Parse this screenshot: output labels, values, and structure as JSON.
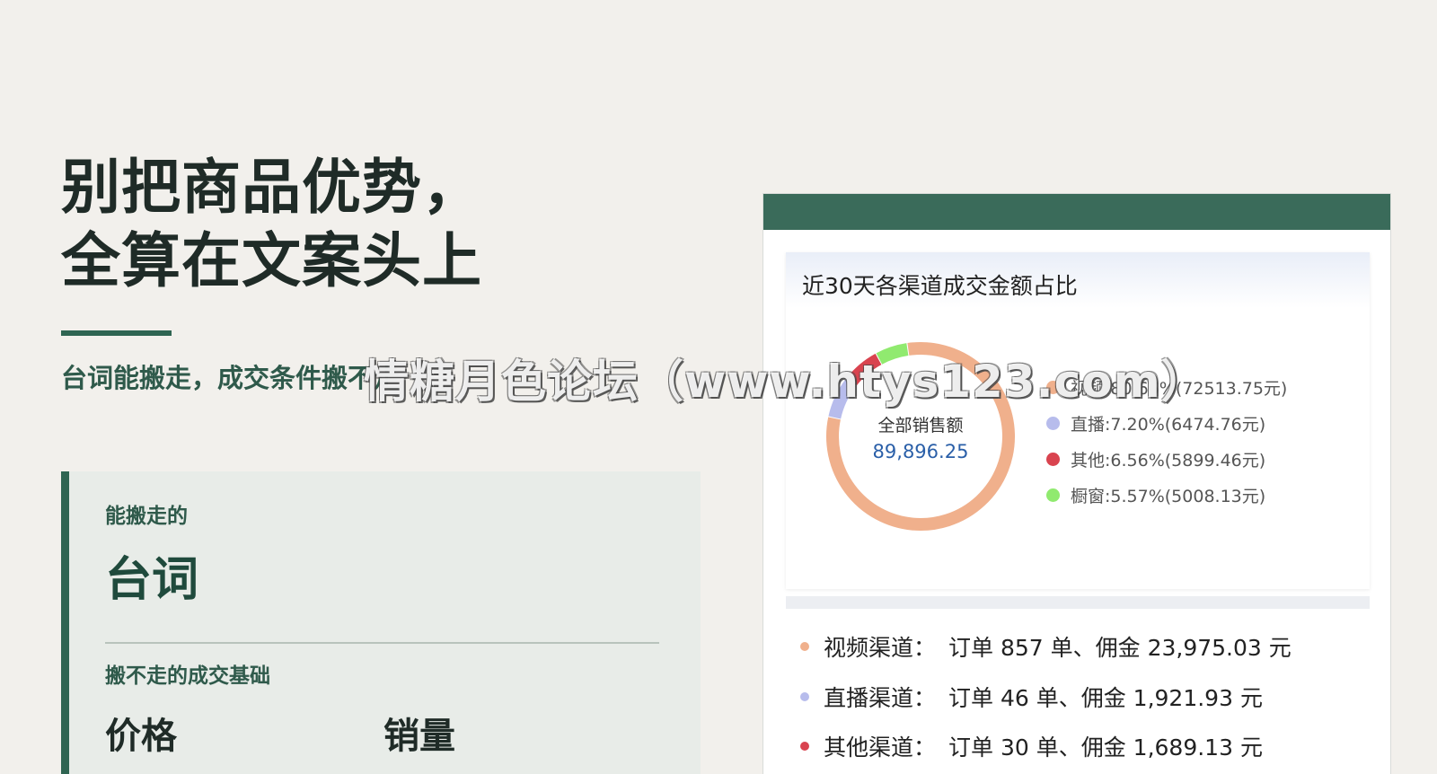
{
  "headline": {
    "line1": "别把商品优势，",
    "line2": "全算在文案头上"
  },
  "subtitle": "台词能搬走，成交条件搬不走",
  "info_card": {
    "kicker1": "能搬走的",
    "main": "台词",
    "kicker2": "搬不走的成交基础",
    "items": [
      "价格",
      "销量"
    ]
  },
  "colors": {
    "accent_green": "#2f6552",
    "panel_bar": "#3a6b5a",
    "video": "#f0b08c",
    "live": "#b7bcec",
    "other": "#d9434f",
    "window": "#90ea6f",
    "value_blue": "#2a5fa8"
  },
  "panel": {
    "chart_title": "近30天各渠道成交金额占比",
    "center_label": "全部销售额",
    "center_value": "89,896.25",
    "legend": [
      {
        "label": "视频:80.66%(72513.75元)",
        "color": "#f0b08c"
      },
      {
        "label": "直播:7.20%(6474.76元)",
        "color": "#b7bcec"
      },
      {
        "label": "其他:6.56%(5899.46元)",
        "color": "#d9434f"
      },
      {
        "label": "橱窗:5.57%(5008.13元)",
        "color": "#90ea6f"
      }
    ],
    "lines": [
      {
        "label": "视频渠道：",
        "text": "订单 857 单、佣金 23,975.03 元",
        "color": "#f0b08c"
      },
      {
        "label": "直播渠道：",
        "text": "订单 46 单、佣金 1,921.93 元",
        "color": "#b7bcec"
      },
      {
        "label": "其他渠道：",
        "text": "订单 30 单、佣金 1,689.13 元",
        "color": "#d9434f"
      }
    ]
  },
  "chart_data": {
    "type": "pie",
    "title": "近30天各渠道成交金额占比",
    "categories": [
      "视频",
      "直播",
      "其他",
      "橱窗"
    ],
    "values": [
      72513.75,
      6474.76,
      5899.46,
      5008.13
    ],
    "percentages": [
      80.66,
      7.2,
      6.56,
      5.57
    ],
    "total": 89896.25,
    "donut": true,
    "colors": [
      "#f0b08c",
      "#b7bcec",
      "#d9434f",
      "#90ea6f"
    ],
    "legend": "right"
  },
  "watermark": "情糖月色论坛（www.htys123.com）"
}
